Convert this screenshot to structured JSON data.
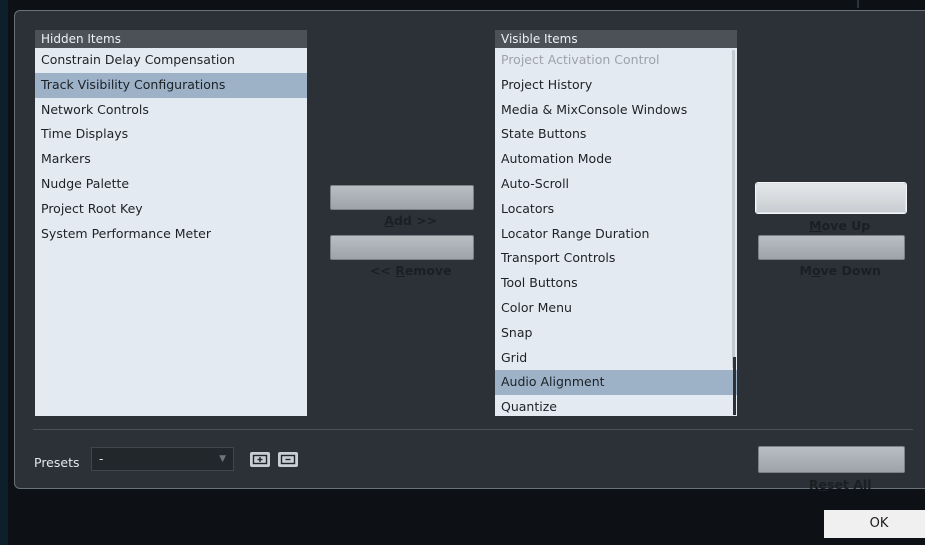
{
  "hidden_list": {
    "header": "Hidden Items",
    "items": [
      {
        "label": "Constrain Delay Compensation",
        "state": "normal"
      },
      {
        "label": "Track Visibility Configurations",
        "state": "selected"
      },
      {
        "label": "Network Controls",
        "state": "normal"
      },
      {
        "label": "Time Displays",
        "state": "normal"
      },
      {
        "label": "Markers",
        "state": "normal"
      },
      {
        "label": "Nudge Palette",
        "state": "normal"
      },
      {
        "label": "Project Root Key",
        "state": "normal"
      },
      {
        "label": "System Performance Meter",
        "state": "normal"
      }
    ]
  },
  "visible_list": {
    "header": "Visible Items",
    "items": [
      {
        "label": "Project Activation Control",
        "state": "disabled"
      },
      {
        "label": "Project History",
        "state": "normal"
      },
      {
        "label": "Media & MixConsole Windows",
        "state": "normal"
      },
      {
        "label": "State Buttons",
        "state": "normal"
      },
      {
        "label": "Automation Mode",
        "state": "normal"
      },
      {
        "label": "Auto-Scroll",
        "state": "normal"
      },
      {
        "label": "Locators",
        "state": "normal"
      },
      {
        "label": "Locator Range Duration",
        "state": "normal"
      },
      {
        "label": "Transport Controls",
        "state": "normal"
      },
      {
        "label": "Tool Buttons",
        "state": "normal"
      },
      {
        "label": "Color Menu",
        "state": "normal"
      },
      {
        "label": "Snap",
        "state": "normal"
      },
      {
        "label": "Grid",
        "state": "normal"
      },
      {
        "label": "Audio Alignment",
        "state": "selected"
      },
      {
        "label": "Quantize",
        "state": "normal"
      }
    ]
  },
  "buttons": {
    "add": {
      "pre": "",
      "ul": "A",
      "post": "dd >>"
    },
    "remove": {
      "pre": "<< ",
      "ul": "R",
      "post": "emove"
    },
    "move_up": {
      "pre": "",
      "ul": "M",
      "post": "ove Up"
    },
    "move_down": {
      "pre": "M",
      "ul": "o",
      "post": "ve Down"
    },
    "reset_all": {
      "pre": "R",
      "ul": "e",
      "post": "set All"
    },
    "ok": "OK"
  },
  "presets": {
    "label": "Presets",
    "value": "-",
    "save_icon": "save-preset-icon",
    "delete_icon": "delete-preset-icon"
  },
  "colors": {
    "panel": "#2b3137",
    "list_bg": "#e3eaf1",
    "selection": "#9db1c7",
    "header": "#4b5157"
  }
}
